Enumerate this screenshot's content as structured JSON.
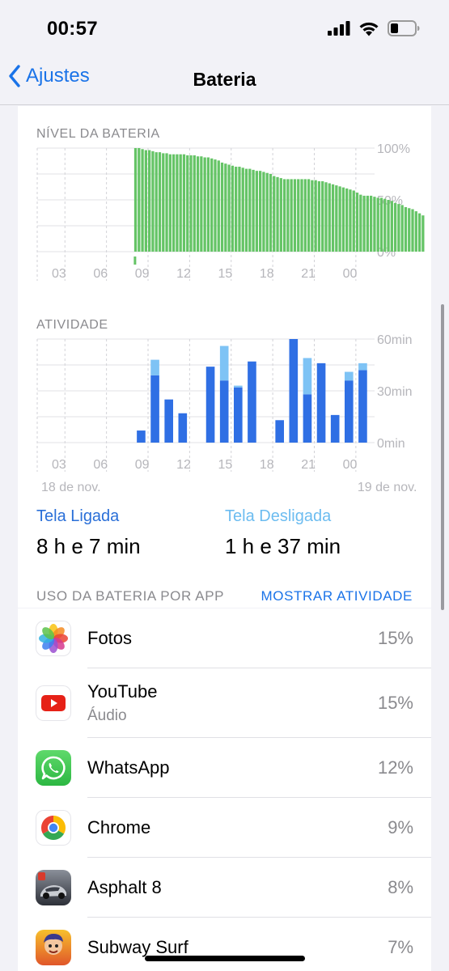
{
  "status": {
    "time": "00:57"
  },
  "nav": {
    "back_label": "Ajustes",
    "title": "Bateria"
  },
  "battery_level": {
    "label": "NÍVEL DA BATERIA",
    "y_ticks": [
      "100%",
      "50%",
      "0%"
    ],
    "x_ticks": [
      "03",
      "06",
      "09",
      "12",
      "15",
      "18",
      "21",
      "00"
    ]
  },
  "activity": {
    "label": "ATIVIDADE",
    "y_ticks": [
      "60min",
      "30min",
      "0min"
    ],
    "x_ticks": [
      "03",
      "06",
      "09",
      "12",
      "15",
      "18",
      "21",
      "00"
    ],
    "date_left": "18 de nov.",
    "date_right": "19 de nov."
  },
  "screen_on": {
    "label": "Tela Ligada",
    "value": "8 h e 7 min"
  },
  "screen_off": {
    "label": "Tela Desligada",
    "value": "1 h e 37 min"
  },
  "usage": {
    "title": "USO DA BATERIA POR APP",
    "toggle": "MOSTRAR ATIVIDADE",
    "apps": [
      {
        "name": "Fotos",
        "sub": "",
        "pct": "15%"
      },
      {
        "name": "YouTube",
        "sub": "Áudio",
        "pct": "15%"
      },
      {
        "name": "WhatsApp",
        "sub": "",
        "pct": "12%"
      },
      {
        "name": "Chrome",
        "sub": "",
        "pct": "9%"
      },
      {
        "name": "Asphalt 8",
        "sub": "",
        "pct": "8%"
      },
      {
        "name": "Subway Surf",
        "sub": "",
        "pct": "7%"
      }
    ]
  },
  "chart_data": [
    {
      "type": "bar",
      "title": "NÍVEL DA BATERIA",
      "ylim": [
        0,
        100
      ],
      "y_unit": "%",
      "x_tick_labels": [
        "03",
        "06",
        "09",
        "12",
        "15",
        "18",
        "21",
        "00"
      ],
      "x_start_hour": 1,
      "x_end_hour": 25,
      "bar_width_hours": 0.25,
      "series": [
        {
          "color": "#65c466",
          "start_hour": 8,
          "values": [
            100,
            100,
            99,
            98,
            98,
            97,
            96,
            96,
            95,
            95,
            94,
            94,
            94,
            94,
            94,
            93,
            93,
            93,
            92,
            92,
            91,
            91,
            90,
            89,
            88,
            86,
            85,
            84,
            83,
            82,
            82,
            81,
            80,
            80,
            79,
            78,
            78,
            77,
            76,
            75,
            73,
            72,
            71,
            70,
            70,
            70,
            70,
            70,
            70,
            70,
            70,
            69,
            69,
            68,
            68,
            67,
            66,
            65,
            64,
            63,
            62,
            61,
            60,
            59,
            57,
            55,
            54,
            54,
            54,
            53,
            52,
            52,
            51,
            50,
            49,
            47,
            46,
            45,
            43,
            42,
            41,
            39,
            37,
            35,
            34,
            34,
            33,
            32
          ]
        }
      ],
      "grid": true
    },
    {
      "type": "bar",
      "title": "ATIVIDADE",
      "ylim": [
        0,
        60
      ],
      "y_unit": "min",
      "x_tick_labels": [
        "03",
        "06",
        "09",
        "12",
        "15",
        "18",
        "21",
        "00"
      ],
      "x_start_hour": 1,
      "x_end_hour": 25,
      "hours": [
        8,
        9,
        10,
        11,
        13,
        14,
        15,
        16,
        18,
        19,
        20,
        21,
        22,
        23,
        24
      ],
      "series": [
        {
          "name": "Tela Ligada",
          "color": "#2f6fe4",
          "values": [
            7,
            39,
            25,
            17,
            44,
            36,
            32,
            47,
            13,
            60,
            28,
            46,
            16,
            36,
            42
          ]
        },
        {
          "name": "Tela Desligada",
          "color": "#7ec3f5",
          "values": [
            0,
            9,
            0,
            0,
            0,
            20,
            1,
            0,
            0,
            0,
            21,
            0,
            0,
            5,
            4
          ]
        }
      ],
      "date_labels": [
        "18 de nov.",
        "19 de nov."
      ],
      "grid": true
    }
  ]
}
